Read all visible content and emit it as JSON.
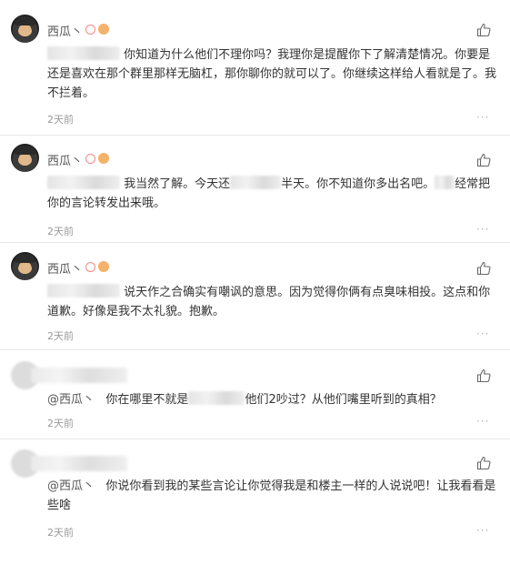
{
  "comments": [
    {
      "user": "西瓜丶",
      "text": "你知道为什么他们不理你吗？我理你是提醒你下了解清楚情况。你要是还是喜欢在那个群里那样无脑杠，那你聊你的就可以了。你继续这样给人看就是了。我不拦着。",
      "time": "2天前"
    },
    {
      "user": "西瓜丶",
      "text_a": "我当然了解。今天还",
      "text_b": "半天。你不知道你多出名吧。",
      "text_c": "经常把你的言论转发出来哦。",
      "time": "2天前"
    },
    {
      "user": "西瓜丶",
      "text": "说天作之合确实有嘲讽的意思。因为觉得你俩有点臭味相投。这点和你道歉。好像是我不太礼貌。抱歉。",
      "time": "2天前"
    },
    {
      "reply_to": "@西瓜丶",
      "text_a": "你在哪里不就是",
      "text_b": "他们2吵过？从他们嘴里听到的真相？",
      "time": "2天前"
    },
    {
      "reply_to": "@西瓜丶",
      "text": "你说你看到我的某些言论让你觉得我是和楼主一样的人说说吧！让我看看是些啥",
      "time": "2天前"
    }
  ],
  "icons": {
    "like": "thumbs-up-icon",
    "more": "more-dots-icon"
  }
}
